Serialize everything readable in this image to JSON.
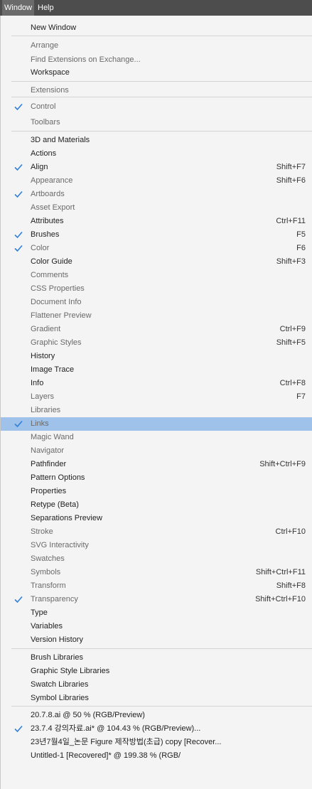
{
  "menubar": {
    "window": "Window",
    "help": "Help"
  },
  "items": [
    {
      "label": "New Window",
      "shortcut": "",
      "checked": false
    },
    {
      "label": "Arrange",
      "shortcut": "",
      "checked": false
    },
    {
      "label": "Find Extensions on Exchange...",
      "shortcut": "",
      "checked": false
    },
    {
      "label": "Workspace",
      "shortcut": "",
      "checked": false
    },
    {
      "label": "Extensions",
      "shortcut": "",
      "checked": false
    },
    {
      "label": "Control",
      "shortcut": "",
      "checked": true
    },
    {
      "label": "Toolbars",
      "shortcut": "",
      "checked": false
    },
    {
      "label": "3D and Materials",
      "shortcut": "",
      "checked": false
    },
    {
      "label": "Actions",
      "shortcut": "",
      "checked": false
    },
    {
      "label": "Align",
      "shortcut": "Shift+F7",
      "checked": true
    },
    {
      "label": "Appearance",
      "shortcut": "Shift+F6",
      "checked": false
    },
    {
      "label": "Artboards",
      "shortcut": "",
      "checked": true
    },
    {
      "label": "Asset Export",
      "shortcut": "",
      "checked": false
    },
    {
      "label": "Attributes",
      "shortcut": "Ctrl+F11",
      "checked": false
    },
    {
      "label": "Brushes",
      "shortcut": "F5",
      "checked": true
    },
    {
      "label": "Color",
      "shortcut": "F6",
      "checked": true
    },
    {
      "label": "Color Guide",
      "shortcut": "Shift+F3",
      "checked": false
    },
    {
      "label": "Comments",
      "shortcut": "",
      "checked": false
    },
    {
      "label": "CSS Properties",
      "shortcut": "",
      "checked": false
    },
    {
      "label": "Document Info",
      "shortcut": "",
      "checked": false
    },
    {
      "label": "Flattener Preview",
      "shortcut": "",
      "checked": false
    },
    {
      "label": "Gradient",
      "shortcut": "Ctrl+F9",
      "checked": false
    },
    {
      "label": "Graphic Styles",
      "shortcut": "Shift+F5",
      "checked": false
    },
    {
      "label": "History",
      "shortcut": "",
      "checked": false
    },
    {
      "label": "Image Trace",
      "shortcut": "",
      "checked": false
    },
    {
      "label": "Info",
      "shortcut": "Ctrl+F8",
      "checked": false
    },
    {
      "label": "Layers",
      "shortcut": "F7",
      "checked": false
    },
    {
      "label": "Libraries",
      "shortcut": "",
      "checked": false
    },
    {
      "label": "Links",
      "shortcut": "",
      "checked": true
    },
    {
      "label": "Magic Wand",
      "shortcut": "",
      "checked": false
    },
    {
      "label": "Navigator",
      "shortcut": "",
      "checked": false
    },
    {
      "label": "Pathfinder",
      "shortcut": "Shift+Ctrl+F9",
      "checked": false
    },
    {
      "label": "Pattern Options",
      "shortcut": "",
      "checked": false
    },
    {
      "label": "Properties",
      "shortcut": "",
      "checked": false
    },
    {
      "label": "Retype (Beta)",
      "shortcut": "",
      "checked": false
    },
    {
      "label": "Separations Preview",
      "shortcut": "",
      "checked": false
    },
    {
      "label": "Stroke",
      "shortcut": "Ctrl+F10",
      "checked": false
    },
    {
      "label": "SVG Interactivity",
      "shortcut": "",
      "checked": false
    },
    {
      "label": "Swatches",
      "shortcut": "",
      "checked": false
    },
    {
      "label": "Symbols",
      "shortcut": "Shift+Ctrl+F11",
      "checked": false
    },
    {
      "label": "Transform",
      "shortcut": "Shift+F8",
      "checked": false
    },
    {
      "label": "Transparency",
      "shortcut": "Shift+Ctrl+F10",
      "checked": true
    },
    {
      "label": "Type",
      "shortcut": "",
      "checked": false
    },
    {
      "label": "Variables",
      "shortcut": "",
      "checked": false
    },
    {
      "label": "Version History",
      "shortcut": "",
      "checked": false
    },
    {
      "label": "Brush Libraries",
      "shortcut": "",
      "checked": false
    },
    {
      "label": "Graphic Style Libraries",
      "shortcut": "",
      "checked": false
    },
    {
      "label": "Swatch Libraries",
      "shortcut": "",
      "checked": false
    },
    {
      "label": "Symbol Libraries",
      "shortcut": "",
      "checked": false
    },
    {
      "label": "20.7.8.ai @ 50 % (RGB/Preview)",
      "shortcut": "",
      "checked": false
    },
    {
      "label": "23.7.4 강의자료.ai* @ 104.43 % (RGB/Preview)...",
      "shortcut": "",
      "checked": true
    },
    {
      "label": "23년7월4일_논문 Figure 제작방법(초급) copy [Recover...",
      "shortcut": "",
      "checked": false
    },
    {
      "label": "Untitled-1 [Recovered]* @ 199.38 % (RGB/",
      "shortcut": "",
      "checked": false
    }
  ],
  "colors": {
    "highlight": "#9ec2ea",
    "check": "#2f7fd8"
  }
}
